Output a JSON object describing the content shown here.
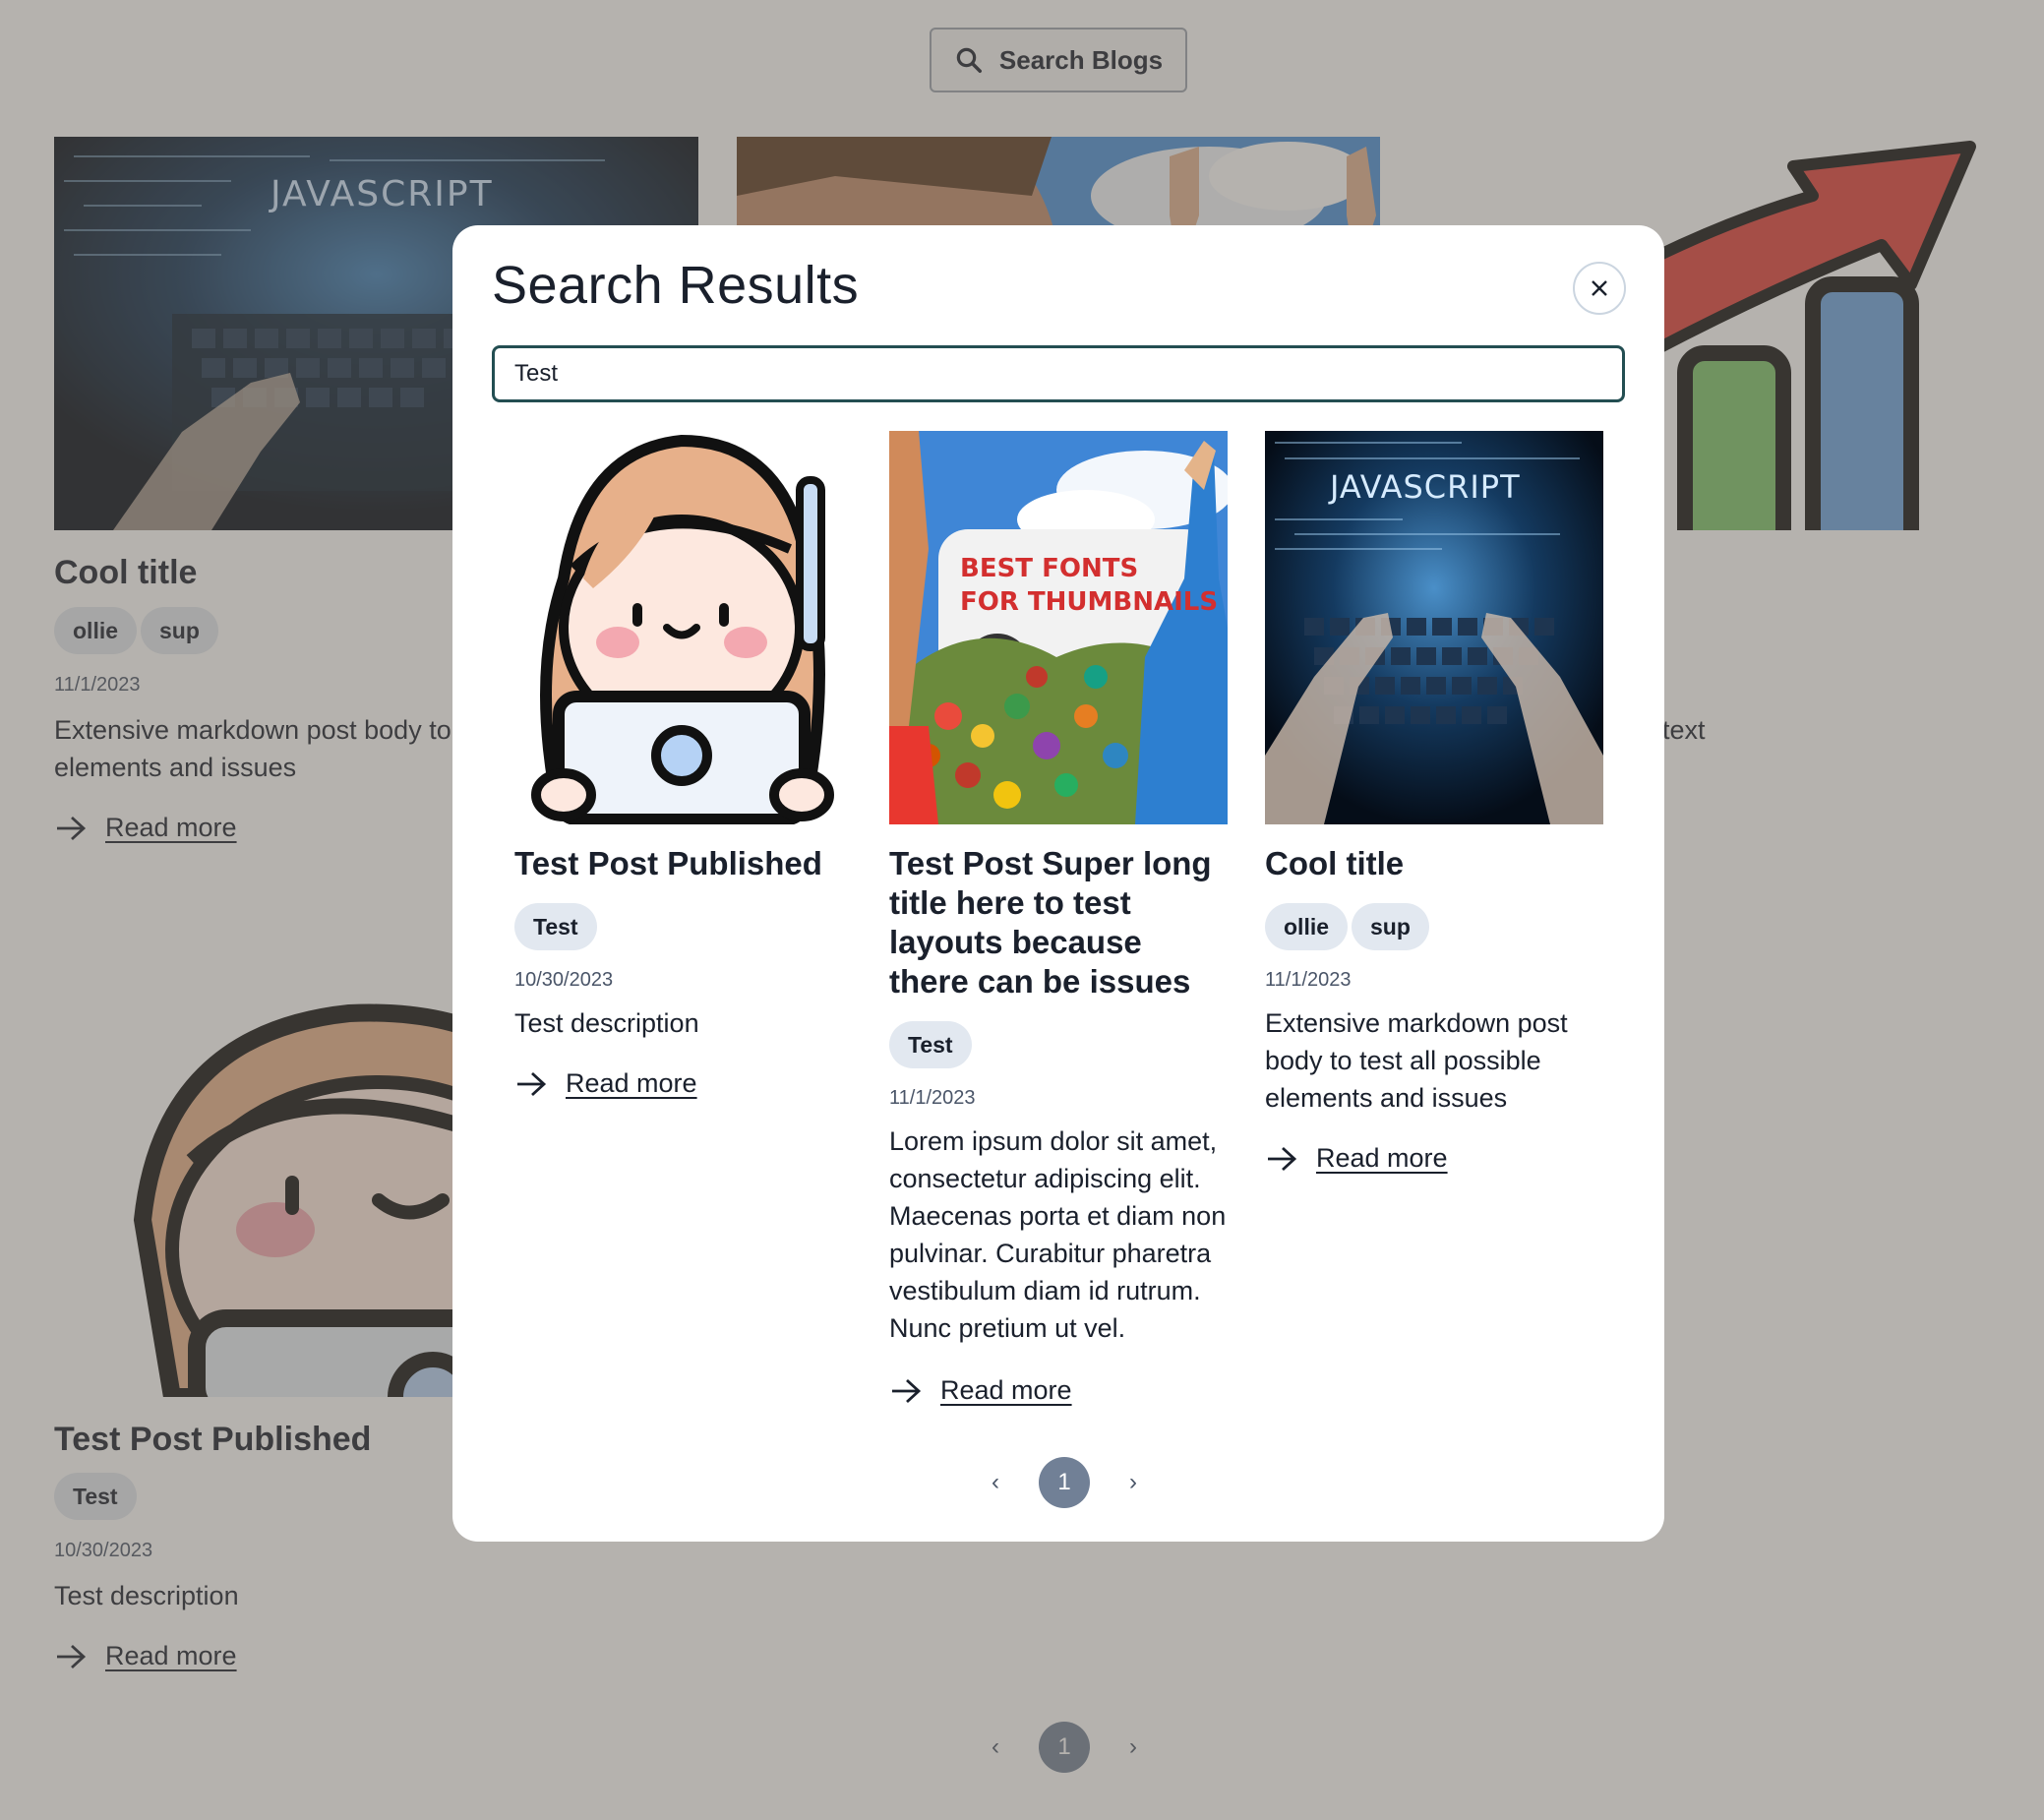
{
  "header": {
    "search_button_label": "Search Blogs"
  },
  "background": {
    "posts": [
      {
        "title": "Cool title",
        "tags": [
          "ollie",
          "sup"
        ],
        "date": "11/1/2023",
        "description": "Extensive markdown post body to test all possible elements and issues",
        "read_more": "Read more"
      },
      {
        "description_fragment": "text"
      },
      {
        "title": "Test Post Published",
        "tags": [
          "Test"
        ],
        "date": "10/30/2023",
        "description": "Test description",
        "read_more": "Read more"
      }
    ],
    "pagination": {
      "prev": "‹",
      "current": "1",
      "next": "›"
    }
  },
  "modal": {
    "title": "Search Results",
    "search_value": "Test",
    "results": [
      {
        "title": "Test Post Published",
        "tags": [
          "Test"
        ],
        "date": "10/30/2023",
        "description": "Test description",
        "read_more": "Read more",
        "thumbnail": "cartoon-girl-laptop"
      },
      {
        "title": "Test Post Super long title here to test layouts because there can be issues",
        "tags": [
          "Test"
        ],
        "date": "11/1/2023",
        "description": "Lorem ipsum dolor sit amet, consectetur adipiscing elit. Maecenas porta et diam non pulvinar. Curabitur pharetra vestibulum diam id rutrum. Nunc pretium ut vel.",
        "read_more": "Read more",
        "thumbnail": "best-fonts-for-thumbnails",
        "thumbnail_text": "BEST FONTS FOR THUMBNAILS"
      },
      {
        "title": "Cool title",
        "tags": [
          "ollie",
          "sup"
        ],
        "date": "11/1/2023",
        "description": "Extensive markdown post body to test all possible elements and issues",
        "read_more": "Read more",
        "thumbnail": "javascript-keyboard",
        "thumbnail_text": "JAVASCRIPT"
      }
    ],
    "pagination": {
      "prev": "‹",
      "current": "1",
      "next": "›"
    }
  },
  "colors": {
    "overlay": "#645f55",
    "input_border": "#234e52",
    "tag_bg": "#e2e8f0",
    "page_active": "#718096"
  }
}
